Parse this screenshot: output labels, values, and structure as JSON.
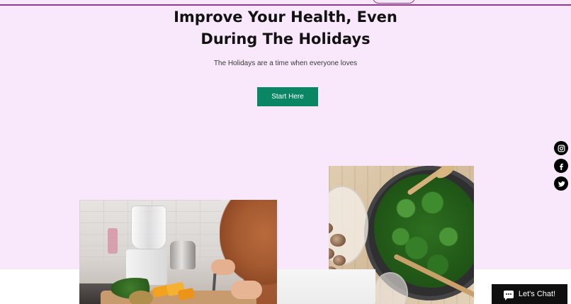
{
  "hero": {
    "title_line1": "Improve Your Health, Even",
    "title_line2": "During The Holidays",
    "subtitle": "The Holidays are a time when everyone loves",
    "cta_label": "Start Here",
    "background_color": "#f9e8fb",
    "cta_color": "#0b8665"
  },
  "social": {
    "items": [
      {
        "icon": "instagram-icon"
      },
      {
        "icon": "facebook-icon"
      },
      {
        "icon": "twitter-icon"
      }
    ]
  },
  "images": [
    {
      "name": "kitchen-photo"
    },
    {
      "name": "kale-pan-photo"
    }
  ],
  "chat": {
    "label": "Let's Chat!",
    "icon": "chat-bubble-icon"
  }
}
